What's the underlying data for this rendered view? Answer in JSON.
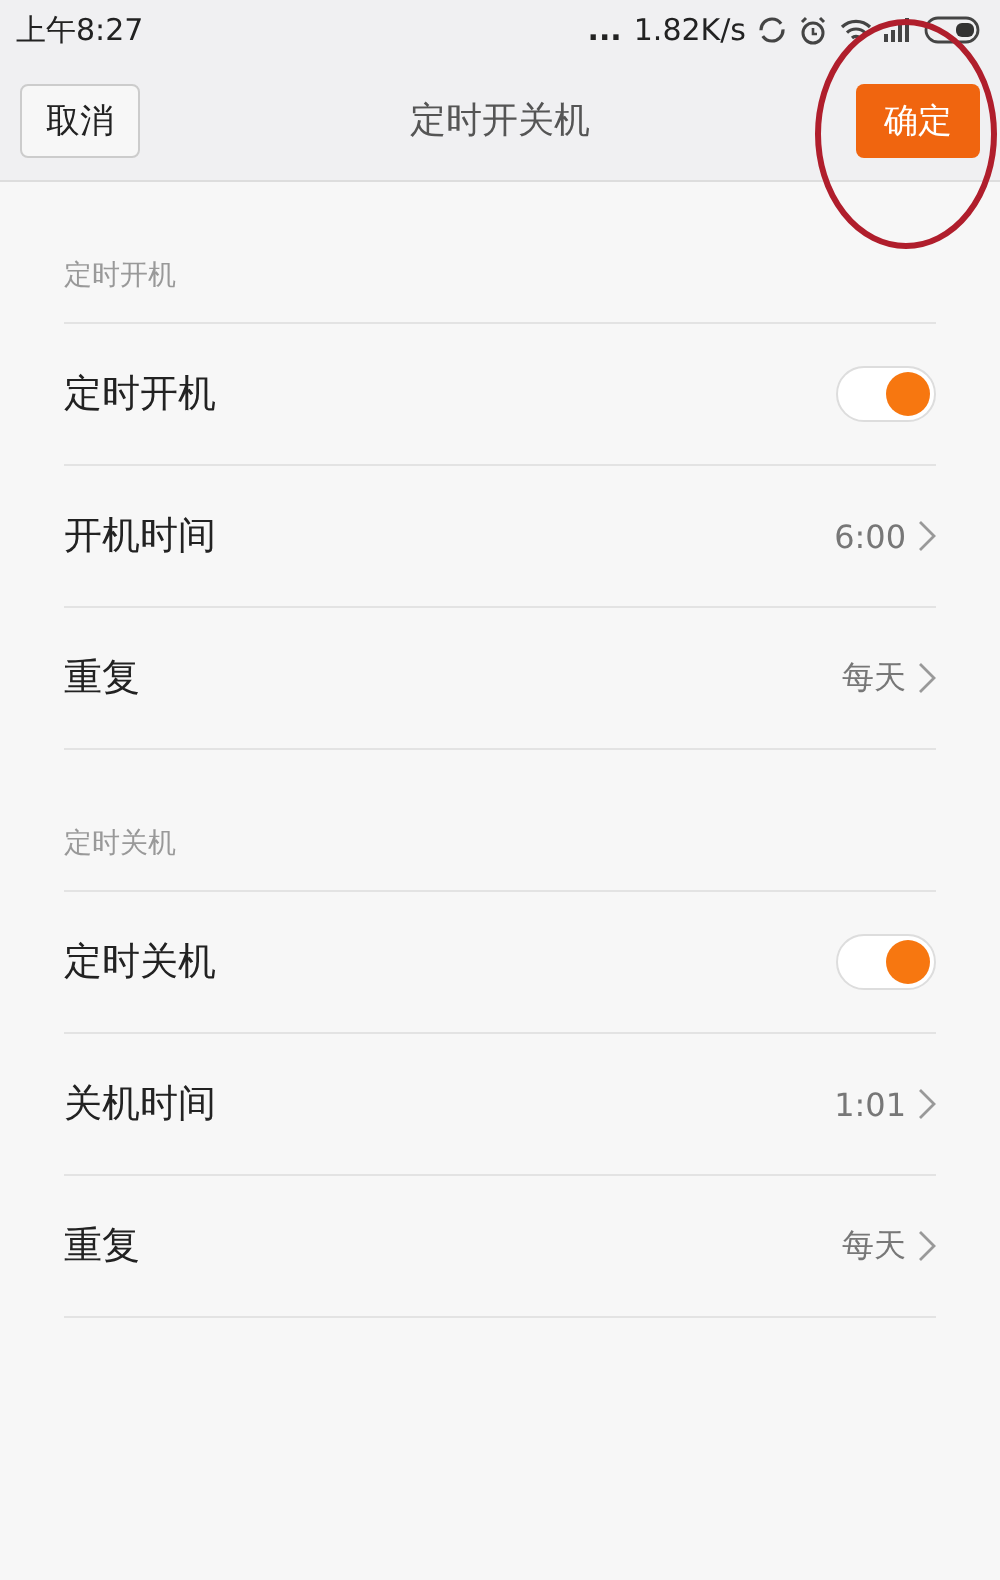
{
  "status_bar": {
    "time": "上午8:27",
    "dots": "...",
    "speed": "1.82K/s"
  },
  "header": {
    "cancel": "取消",
    "title": "定时开关机",
    "confirm": "确定",
    "confirm_annotated": true
  },
  "sections": [
    {
      "label": "定时开机",
      "rows": [
        {
          "kind": "toggle",
          "label": "定时开机",
          "on": true
        },
        {
          "kind": "value",
          "label": "开机时间",
          "value": "6:00"
        },
        {
          "kind": "value",
          "label": "重复",
          "value": "每天"
        }
      ]
    },
    {
      "label": "定时关机",
      "rows": [
        {
          "kind": "toggle",
          "label": "定时关机",
          "on": true
        },
        {
          "kind": "value",
          "label": "关机时间",
          "value": "1:01"
        },
        {
          "kind": "value",
          "label": "重复",
          "value": "每天"
        }
      ]
    }
  ]
}
